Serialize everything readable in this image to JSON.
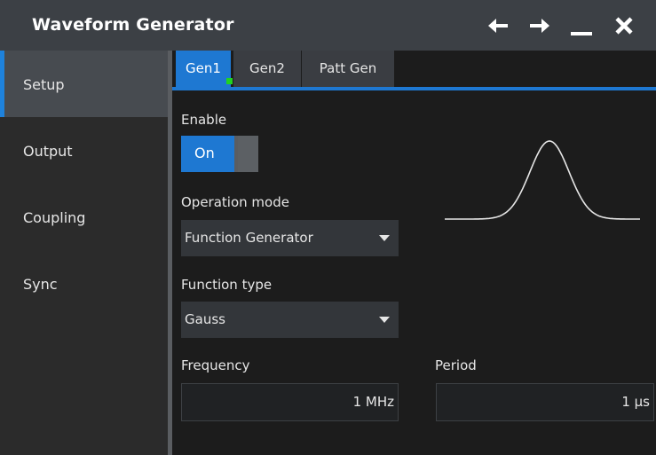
{
  "window": {
    "title": "Waveform Generator"
  },
  "titlebar_buttons": [
    {
      "icon": "arrow-left-icon"
    },
    {
      "icon": "arrow-right-icon"
    },
    {
      "icon": "minimize-icon"
    },
    {
      "icon": "close-icon"
    }
  ],
  "sidebar": {
    "items": [
      {
        "label": "Setup",
        "active": true
      },
      {
        "label": "Output",
        "active": false
      },
      {
        "label": "Coupling",
        "active": false
      },
      {
        "label": "Sync",
        "active": false
      }
    ]
  },
  "tabs": [
    {
      "label": "Gen1",
      "active": true,
      "indicator_color": "#21d321"
    },
    {
      "label": "Gen2",
      "active": false
    },
    {
      "label": "Patt Gen",
      "active": false
    }
  ],
  "setup": {
    "enable": {
      "label": "Enable",
      "value": "On",
      "checked": true
    },
    "operation_mode": {
      "label": "Operation mode",
      "value": "Function Generator"
    },
    "function_type": {
      "label": "Function type",
      "value": "Gauss"
    },
    "frequency": {
      "label": "Frequency",
      "value": "1 MHz"
    },
    "period": {
      "label": "Period",
      "value": "1 µs"
    },
    "preview": {
      "shape": "gauss"
    }
  },
  "colors": {
    "accent": "#1e78d2",
    "titlebar": "#3c4045",
    "sidebar": "#2b2b2b",
    "sidebar_active": "#474b50",
    "background": "#1c1c1c",
    "indicator": "#21d321"
  }
}
